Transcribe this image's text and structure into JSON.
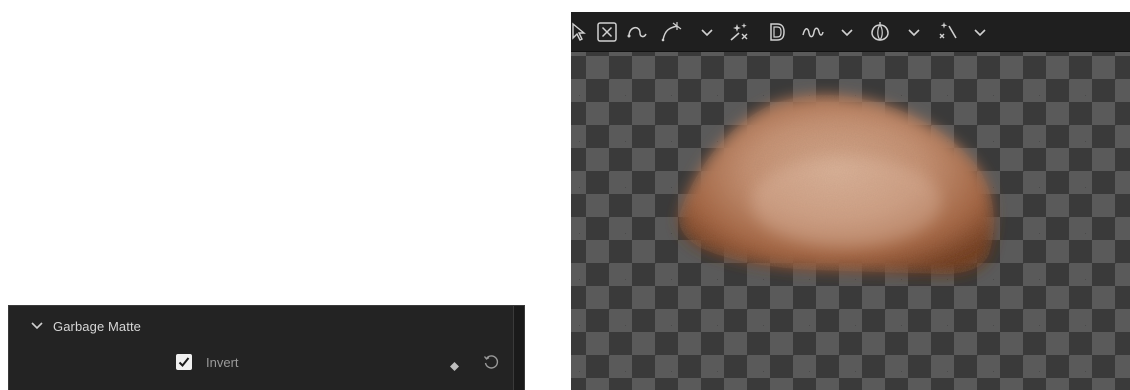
{
  "inspector": {
    "section_title": "Garbage Matte",
    "invert": {
      "label": "Invert",
      "checked": true
    },
    "icons": {
      "collapse": "chevron-down-icon",
      "keyframe": "keyframe-diamond-icon",
      "reset": "reset-icon"
    }
  },
  "viewer": {
    "toolbar_icons": [
      "select-tool-icon",
      "no-mask-icon",
      "polyline-icon",
      "bspline-icon",
      "dropdown-icon",
      "magic-point-icon",
      "d-shape-icon",
      "freehand-icon",
      "dropdown-icon",
      "onion-skin-icon",
      "dropdown-icon",
      "wand-icon",
      "dropdown-icon"
    ],
    "content": "masked skin texture on transparent checkerboard",
    "colors": {
      "checker_dark": "#3a3a3a",
      "checker_light": "#5a5a5a",
      "skin": "#c99070"
    }
  }
}
